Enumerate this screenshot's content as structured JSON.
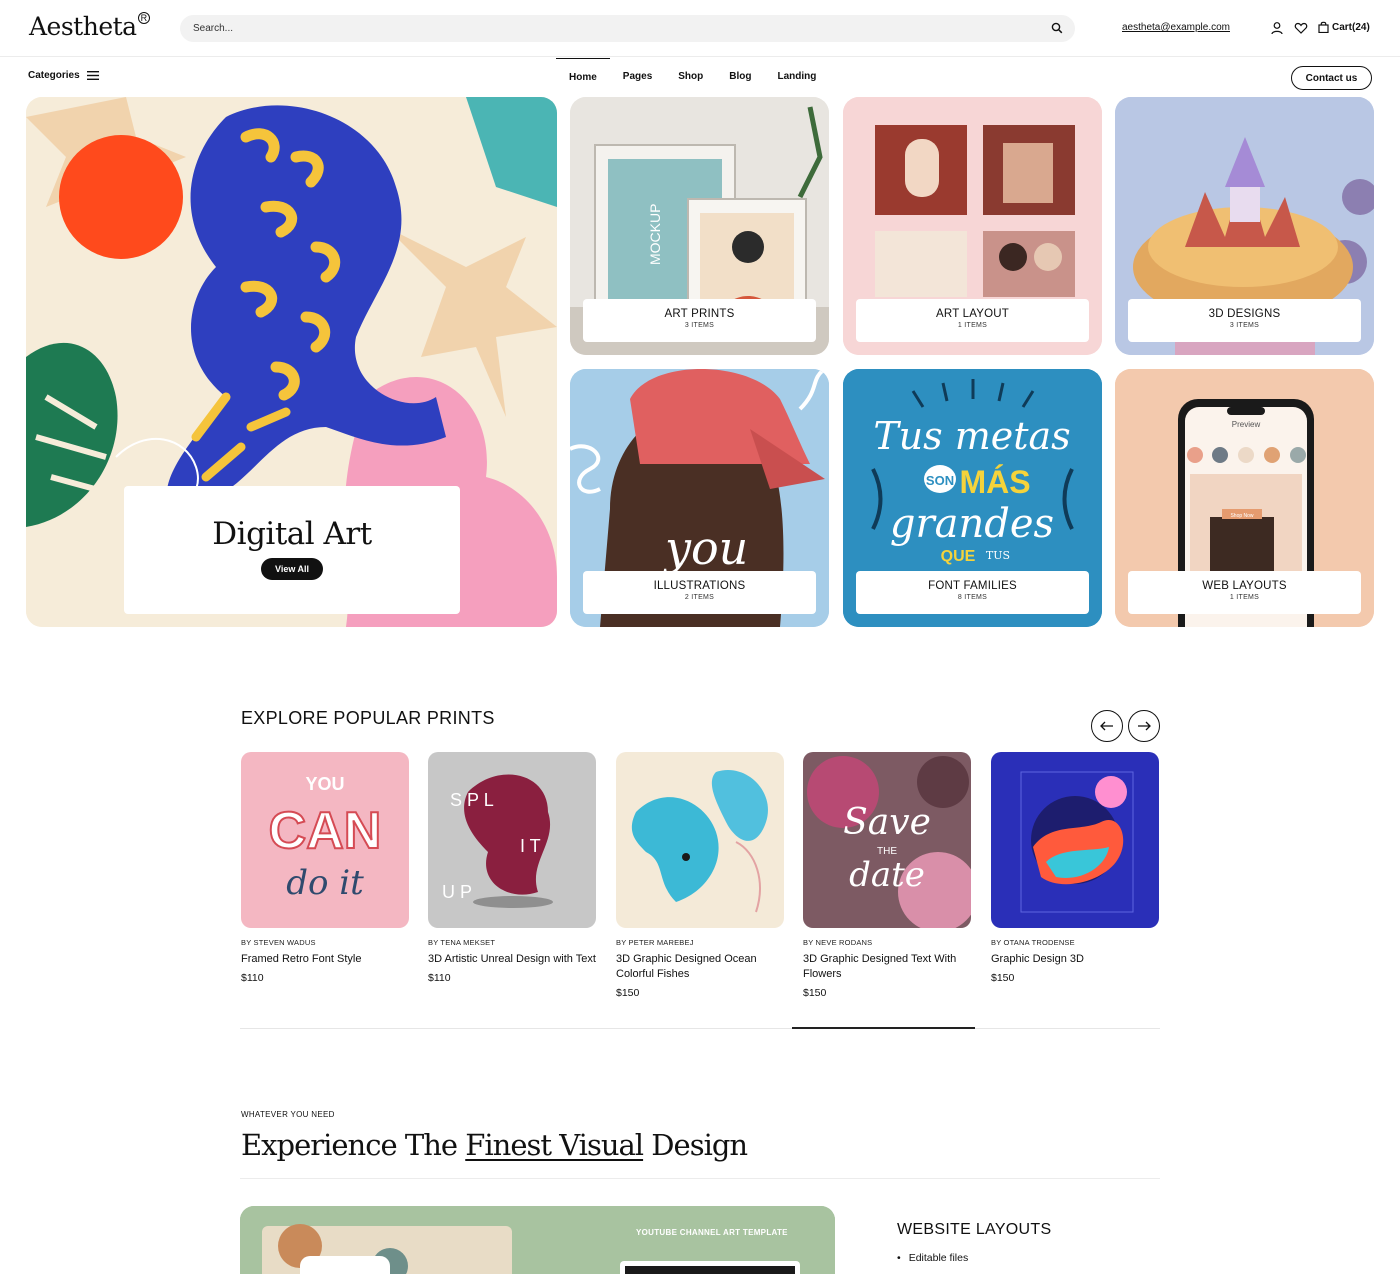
{
  "header": {
    "logo": "Aestheta",
    "logo_mark": "R",
    "search_placeholder": "Search...",
    "email": "aestheta@example.com",
    "cart_label": "Cart(24)"
  },
  "nav": {
    "categories_label": "Categories",
    "items": [
      "Home",
      "Pages",
      "Shop",
      "Blog",
      "Landing"
    ],
    "active": "Home",
    "contact_label": "Contact us"
  },
  "hero": {
    "title": "Digital Art",
    "button": "View All"
  },
  "categories": [
    {
      "title": "ART PRINTS",
      "count": "3 ITEMS"
    },
    {
      "title": "ART LAYOUT",
      "count": "1 ITEMS"
    },
    {
      "title": "3D DESIGNS",
      "count": "3 ITEMS"
    },
    {
      "title": "ILLUSTRATIONS",
      "count": "2 ITEMS"
    },
    {
      "title": "FONT FAMILIES",
      "count": "8 ITEMS"
    },
    {
      "title": "WEB LAYOUTS",
      "count": "1 ITEMS"
    }
  ],
  "tile_art": {
    "mockup": "MOCKUP",
    "illustration_text": "you",
    "lettering_1": "Tus metas",
    "lettering_son": "SON",
    "lettering_mas": "MÁS",
    "lettering_2": "grandes",
    "lettering_que": "QUE",
    "lettering_tus": "TUS",
    "phone_header": "Preview",
    "phone_button": "Shop Now"
  },
  "popular": {
    "title": "EXPLORE POPULAR PRINTS",
    "products": [
      {
        "by": "BY STEVEN WADUS",
        "name": "Framed Retro Font Style",
        "price": "$110",
        "art_1": "YOU",
        "art_2": "CAN",
        "art_3": "do it"
      },
      {
        "by": "BY TENA MEKSET",
        "name": "3D Artistic Unreal Design with Text",
        "price": "$110",
        "art_1": "S  P  L",
        "art_2": "I  T",
        "art_3": "U  P"
      },
      {
        "by": "BY PETER MAREBEJ",
        "name": "3D Graphic Designed Ocean Colorful Fishes",
        "price": "$150"
      },
      {
        "by": "BY NEVE RODANS",
        "name": "3D Graphic Designed Text With Flowers",
        "price": "$150",
        "art_1": "Save",
        "art_2": "THE",
        "art_3": "date"
      },
      {
        "by": "BY OTANA TRODENSE",
        "name": "Graphic Design 3D",
        "price": "$150"
      }
    ]
  },
  "experience": {
    "kicker": "WHATEVER YOU NEED",
    "headline_before": "Experience The ",
    "headline_underlined": "Finest Visual",
    "headline_after": " Design",
    "feature_label": "YOUTUBE CHANNEL ART TEMPLATE",
    "side_title": "WEBSITE LAYOUTS",
    "side_items": [
      "Editable files"
    ]
  },
  "colors": {
    "accent": "#111111",
    "tile_art_prints": "#e9e6e1",
    "tile_art_layout": "#f7d6d6",
    "tile_3d": "#b9c7e4",
    "tile_illustrations": "#a6cde8",
    "tile_fonts": "#2d8fc0",
    "tile_web": "#f3c9ad"
  },
  "icons": [
    "search-icon",
    "user-icon",
    "heart-icon",
    "bag-icon",
    "menu-icon",
    "arrow-left-icon",
    "arrow-right-icon"
  ]
}
